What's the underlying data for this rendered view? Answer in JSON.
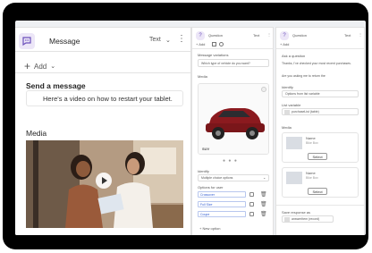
{
  "main": {
    "title": "Message",
    "type_label": "Text",
    "more_label": "⋮",
    "add_label": "Add",
    "send_heading": "Send a message",
    "message_text": "Here's a video on how to restart your tablet.",
    "media_heading": "Media"
  },
  "mid": {
    "title": "Question",
    "type_label": "Text",
    "toolbar_add": "+ Add",
    "msg_variations_label": "Message variations",
    "msg_text": "Which type of vehicle do you want?",
    "media_label": "Media",
    "car_caption": "SUV",
    "identify_label": "Identify",
    "identify_value": "Multiple choice options",
    "options_label": "Options for user",
    "options": [
      "Crossover",
      "Full Size",
      "Coupe"
    ],
    "new_option": "+ New option"
  },
  "right": {
    "title": "Question",
    "type_label": "Text",
    "toolbar_add": "+ Add",
    "ask_label": "Ask a question",
    "q_text_1": "Thanks, I've checked your most recent purchases.",
    "q_text_2": "Are you asking me to return the",
    "identify_label": "Identify",
    "identify_value": "Options from list variable",
    "list_var_label": "List variable",
    "list_var_value": "purchaseList (table)",
    "media_label": "Media",
    "items": [
      {
        "name": "Name",
        "sub": "Bike Box",
        "btn": "Select"
      },
      {
        "name": "Name",
        "sub": "Bike Box",
        "btn": "Select"
      }
    ],
    "save_label": "Save response as",
    "save_value": "answerItem (record)"
  },
  "colors": {
    "accent": "#6b4fbb",
    "link": "#315bd1",
    "car": "#8b1a1f"
  }
}
